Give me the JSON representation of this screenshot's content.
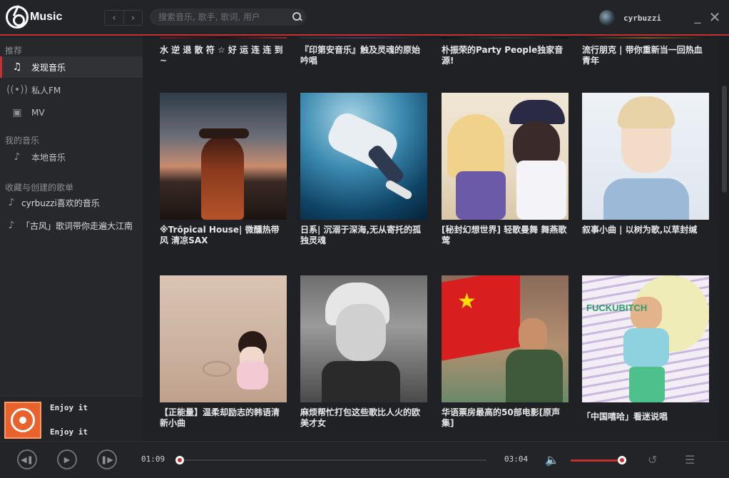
{
  "app": {
    "name": "Music"
  },
  "titlebar": {
    "back_icon": "chevron-left-icon",
    "forward_icon": "chevron-right-icon",
    "search_placeholder": "搜索音乐, 歌手, 歌词, 用户",
    "username": "cyrbuzzi",
    "minimize_glyph": "_",
    "close_glyph": "✕"
  },
  "sidebar": {
    "section_recommend": "推荐",
    "items": [
      {
        "label": "发现音乐",
        "icon": "music-note-icon",
        "active": true
      },
      {
        "label": "私人FM",
        "icon": "radio-icon",
        "active": false
      },
      {
        "label": "MV",
        "icon": "video-icon",
        "active": false
      }
    ],
    "section_my_music": "我的音乐",
    "my_items": [
      {
        "label": "本地音乐",
        "icon": "music-note-icon"
      }
    ],
    "section_playlists": "收藏与创建的歌单",
    "playlists": [
      {
        "label": "cyrbuzzi喜欢的音乐",
        "icon": "music-note-icon"
      },
      {
        "label": "「古风」歌词带你走遍大江南",
        "icon": "music-note-icon"
      }
    ]
  },
  "now_playing": {
    "title": "Enjoy it",
    "artist": "Enjoy it",
    "current_time": "01:09",
    "total_time": "03:04",
    "progress_fraction": 0.0,
    "volume_fraction": 0.95
  },
  "player_icons": [
    "prev-icon",
    "play-icon",
    "next-icon",
    "volume-icon",
    "loop-icon",
    "playlist-icon"
  ],
  "colors": {
    "accent": "#c62f2f",
    "bg": "#1f2124",
    "sidebar": "#26282b"
  },
  "playlists_grid": {
    "row1": [
      {
        "title": "水 逆 退 散 符 ☆ 好 运 连 连 到 ~"
      },
      {
        "title": "『印第安音乐』触及灵魂的原始吟唱"
      },
      {
        "title": "朴振荣的Party People独家音源!"
      },
      {
        "title": "流行朋克 | 带你重新当一回热血青年"
      }
    ],
    "row2": [
      {
        "title": "※Trōpical House| 微醺热带风 清凉SAX"
      },
      {
        "title": "日系| 沉溺于深海,无从寄托的孤独灵魂"
      },
      {
        "title": "[秘封幻想世界] 轻歌曼舞 舞燕歌莺"
      },
      {
        "title": "叙事小曲 | 以树为歌,以草封缄"
      }
    ],
    "row3": [
      {
        "title": "【正能量】温柔却励志的韩语清新小曲"
      },
      {
        "title": "麻烦帮忙打包这些歌比人火的欧美才女"
      },
      {
        "title": "华语票房最高的50部电影[原声集]"
      },
      {
        "title": "「中国嘻哈」看迷说唱"
      }
    ]
  }
}
